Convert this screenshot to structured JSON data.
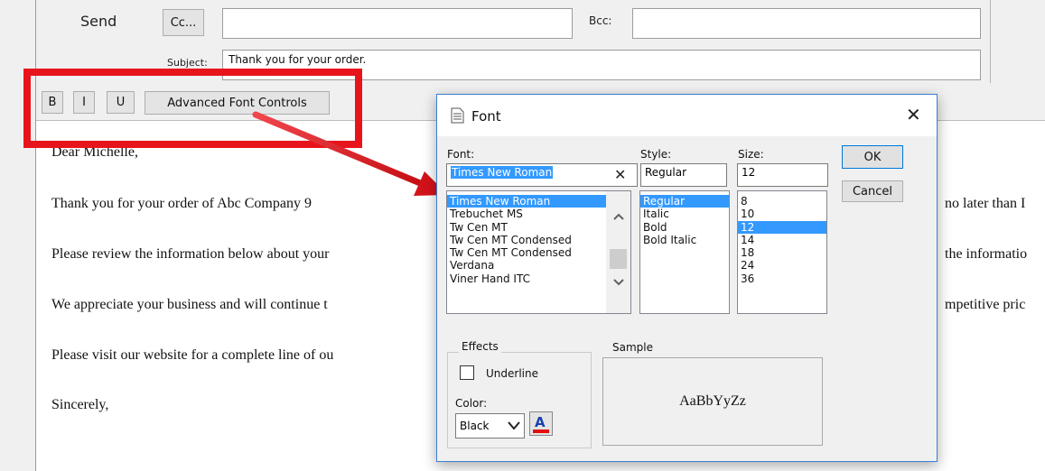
{
  "compose": {
    "send_label": "Send",
    "cc_button": "Cc...",
    "bcc_label": "Bcc:",
    "subject_label": "Subject:",
    "subject_value": "Thank you for your order."
  },
  "toolbar": {
    "bold": "B",
    "italic": "I",
    "underline": "U",
    "advanced": "Advanced Font Controls"
  },
  "body": {
    "greeting": "Dear Michelle,",
    "p1_left": "Thank you for your order of Abc Company 9",
    "p1_right": "no later than I",
    "p2_left": "Please review the information below about your",
    "p2_right": "the informatio",
    "p3_left": "We appreciate your business and will continue t",
    "p3_right": "mpetitive pric",
    "p4_left": "Please visit our website for a complete line of ou",
    "closing": "Sincerely,"
  },
  "dialog": {
    "title": "Font",
    "close_glyph": "✕",
    "font_label": "Font:",
    "style_label": "Style:",
    "size_label": "Size:",
    "font_value": "Times New Roman",
    "style_value": "Regular",
    "size_value": "12",
    "fonts": [
      "Times New Roman",
      "Trebuchet MS",
      "Tw Cen MT",
      "Tw Cen MT Condensed",
      "Tw Cen MT Condensed",
      "Verdana",
      "Viner Hand ITC"
    ],
    "styles": [
      "Regular",
      "Italic",
      "Bold",
      "Bold Italic"
    ],
    "sizes": [
      "8",
      "10",
      "12",
      "14",
      "18",
      "24",
      "36"
    ],
    "ok": "OK",
    "cancel": "Cancel",
    "effects_label": "Effects",
    "underline_label": "Underline",
    "color_label": "Color:",
    "color_value": "Black",
    "sample_label": "Sample",
    "sample_text": "AaBbYyZz"
  },
  "colors": {
    "highlight": "#3399ff",
    "annotation_red": "#e8141c",
    "color_swatch": "#e01010"
  },
  "icons": [
    "document-icon",
    "close-icon",
    "scroll-up-icon",
    "scroll-down-icon",
    "dropdown-chevron-icon",
    "font-color-icon",
    "clear-text-icon",
    "annotation-arrow"
  ]
}
